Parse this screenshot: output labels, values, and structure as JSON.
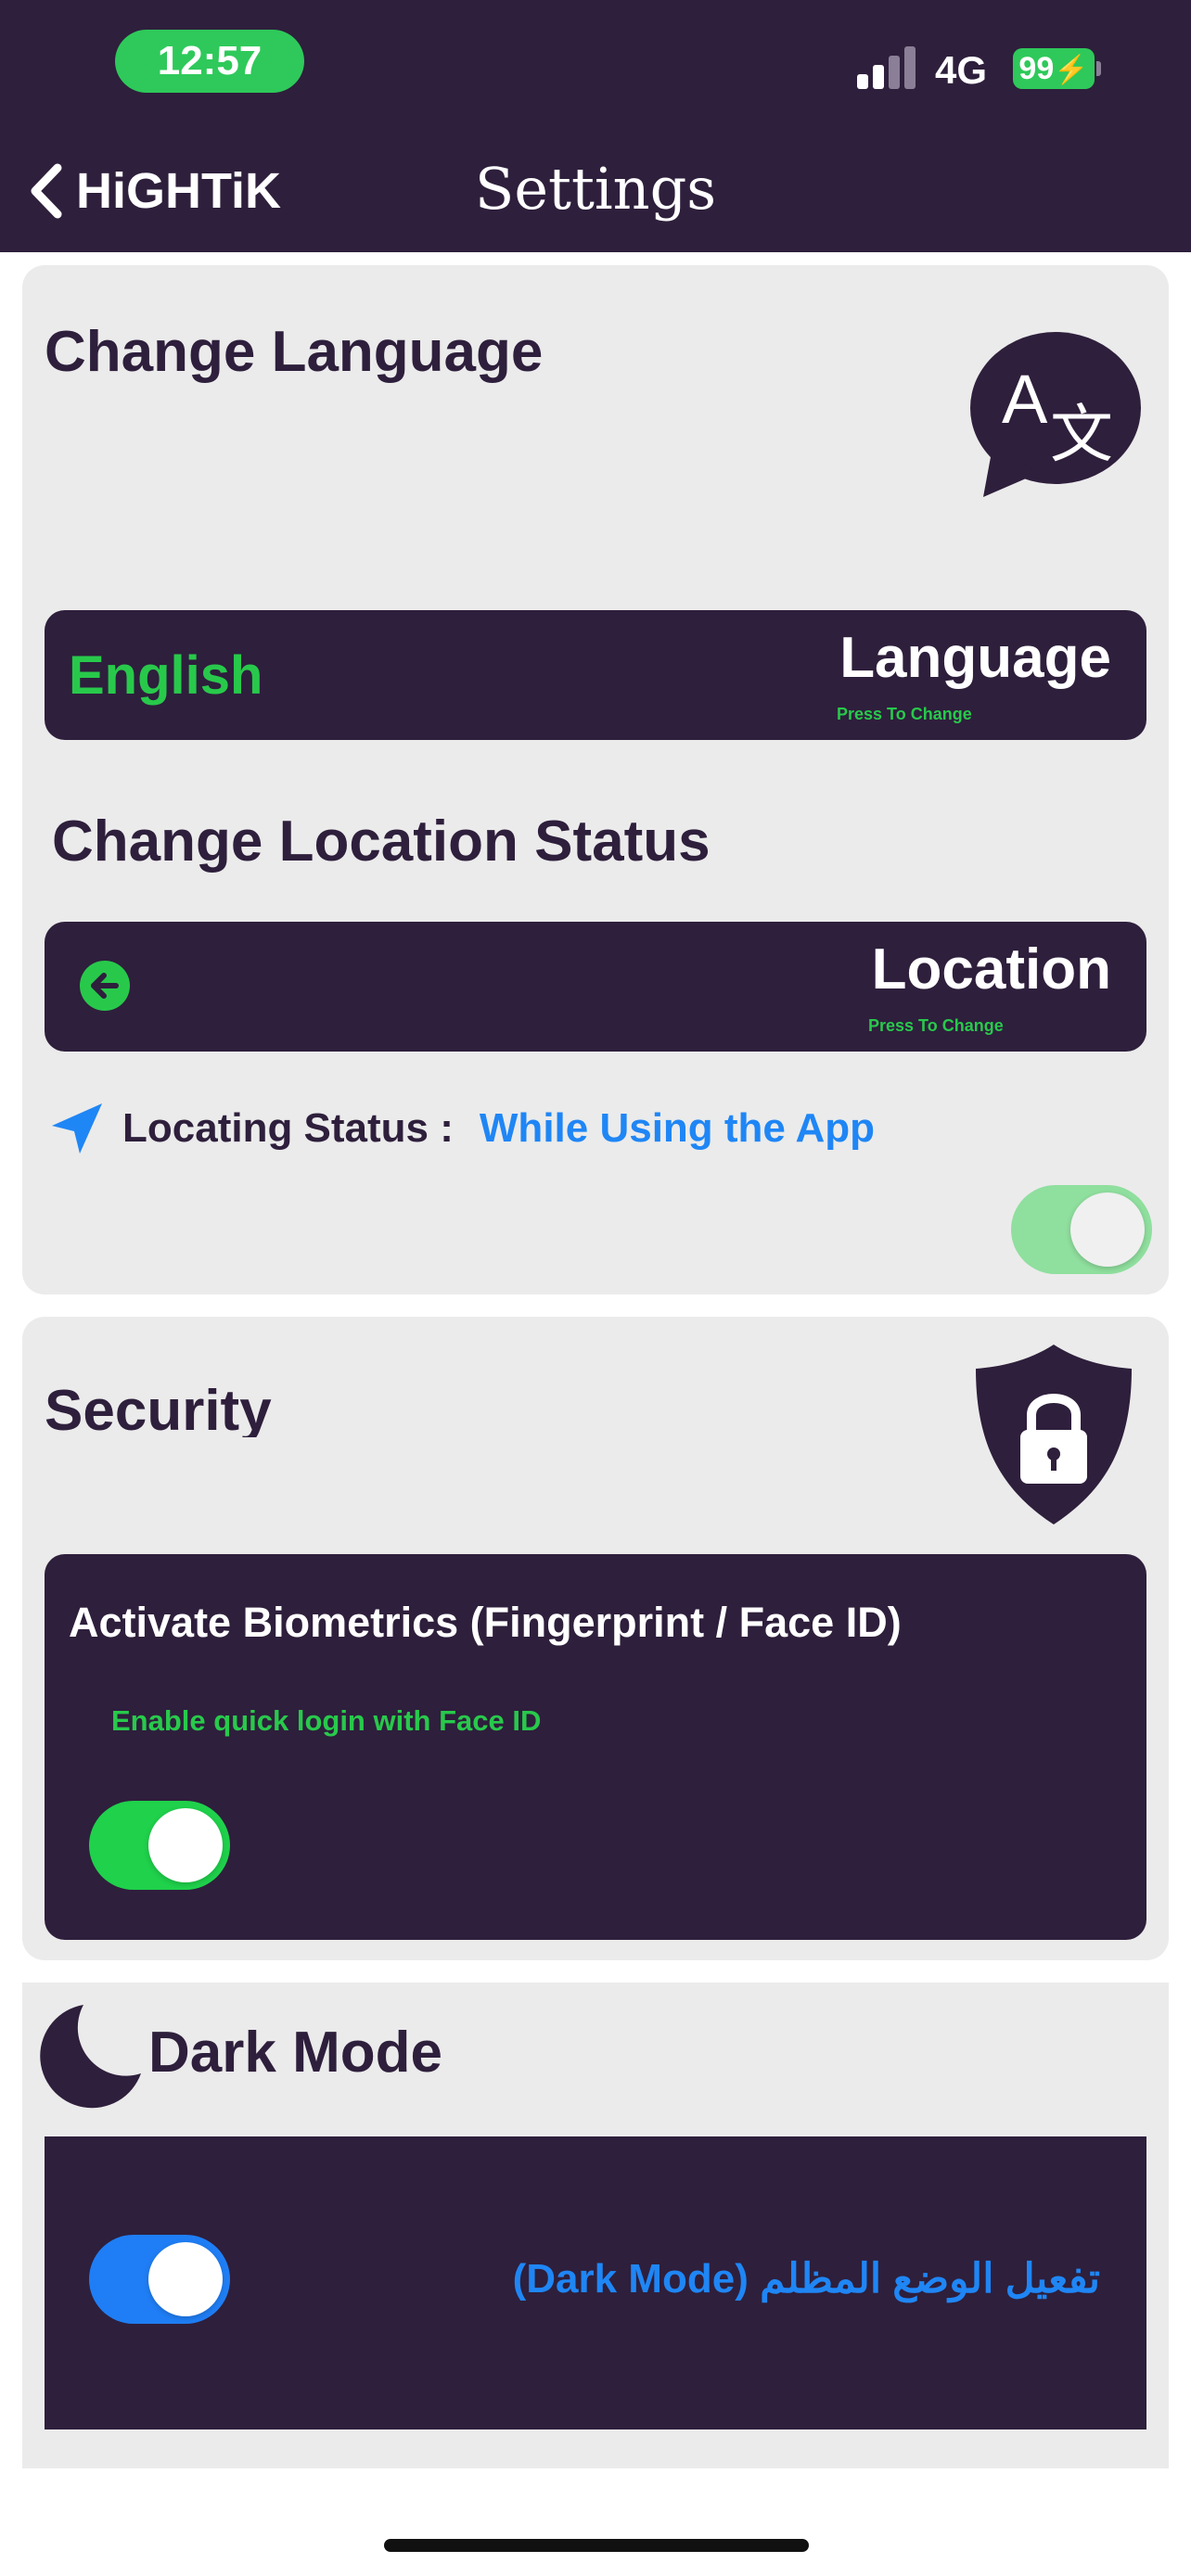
{
  "status_bar": {
    "time": "12:57",
    "network": "4G",
    "battery": "99"
  },
  "nav": {
    "back_label": "HiGHTiK",
    "title": "Settings"
  },
  "language_section": {
    "heading": "Change Language",
    "icon": "translate-bubble-icon",
    "row": {
      "value": "English",
      "label": "Language",
      "hint": "Press To Change"
    }
  },
  "location_section": {
    "heading": "Change Location Status",
    "row": {
      "label": "Location",
      "hint": "Press To Change",
      "icon": "arrow-left-circle-icon"
    },
    "status": {
      "icon": "location-arrow-icon",
      "label": "Locating Status :",
      "value": "While Using the App"
    },
    "toggle_on": true
  },
  "security_section": {
    "heading": "Security",
    "icon": "shield-lock-icon",
    "biometrics": {
      "title": "Activate Biometrics (Fingerprint / Face ID)",
      "subtitle": "Enable quick login with Face ID",
      "toggle_on": true
    }
  },
  "dark_mode_section": {
    "heading": "Dark Mode",
    "icon": "moon-icon",
    "toggle_label": "تفعيل الوضع المظلم (Dark Mode)",
    "toggle_on": true
  },
  "colors": {
    "primary_dark": "#2e1f3c",
    "accent_green": "#28c94b",
    "accent_blue": "#1f86f5",
    "card_background": "#ebebeb"
  }
}
